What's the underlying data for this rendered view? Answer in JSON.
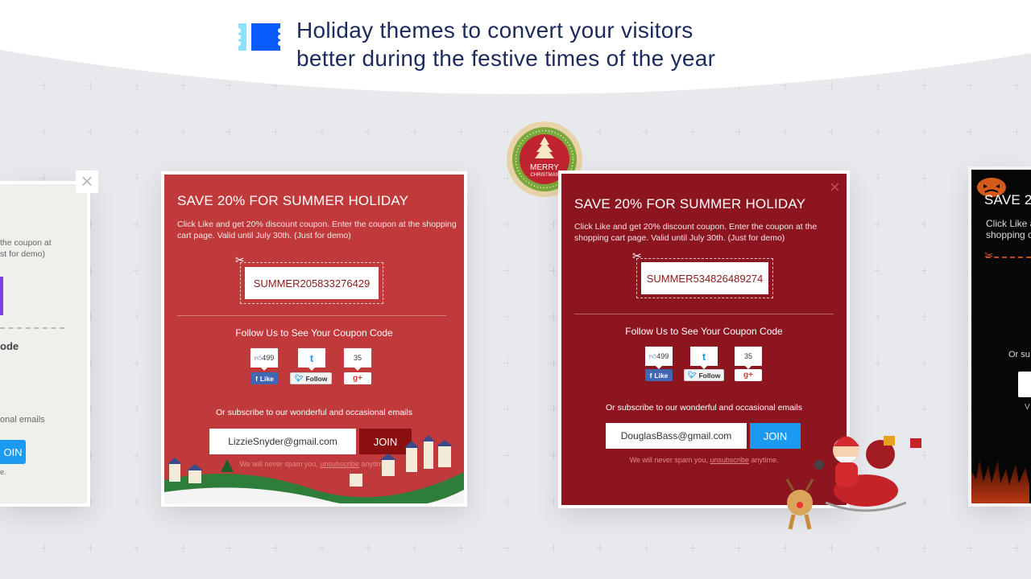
{
  "header": {
    "line1": "Holiday themes to convert your visitors",
    "line2": "better during the festive times of the year",
    "icon": "coupon-ticket-icon",
    "accent": "#0a5cff"
  },
  "left_card": {
    "desc1": "the coupon at",
    "desc2": "st for demo)",
    "follow": "ode",
    "sub": "onal emails",
    "join": "OIN",
    "spam": "e."
  },
  "summer_card": {
    "title": "SAVE 20% FOR SUMMER HOLIDAY",
    "desc": "Click Like and get 20% discount coupon. Enter the coupon at the shopping cart page. Valid until July 30th. (Just for demo)",
    "code": "SUMMER205833276429",
    "follow": "Follow Us to See Your Coupon Code",
    "like_count": "499",
    "like": "Like",
    "follow_btn": "Follow",
    "gplus_count": "35",
    "gplus": "g+",
    "subscribe": "Or subscribe to our wonderful and occasional emails",
    "email": "LizzieSnyder@gmail.com",
    "join": "JOIN",
    "spam_pre": "We will never spam you,",
    "spam_link": "unsubscribe",
    "spam_post": "anytime.",
    "color": "#c0393b"
  },
  "badge": {
    "line1": "MERRY",
    "line2": "CHRISTMAS"
  },
  "christmas_card": {
    "title": "SAVE 20% FOR SUMMER HOLIDAY",
    "desc": "Click Like and get 20% discount coupon. Enter the coupon at the shopping cart page. Valid until July 30th. (Just for demo)",
    "code": "SUMMER534826489274",
    "follow": "Follow Us to See Your Coupon Code",
    "like_count": "499",
    "like": "Like",
    "follow_btn": "Follow",
    "gplus_count": "35",
    "gplus": "g+",
    "subscribe": "Or subscribe to our wonderful and occasional emails",
    "email": "DouglasBass@gmail.com",
    "join": "JOIN",
    "spam_pre": "We will never spam you,",
    "spam_link": "unsubscribe",
    "spam_post": "anytime.",
    "color": "#8d1520"
  },
  "halloween_card": {
    "title": "SAVE 2",
    "desc1": "Click Like a",
    "desc2": "shopping c",
    "sub": "Or su",
    "spam": "V"
  }
}
